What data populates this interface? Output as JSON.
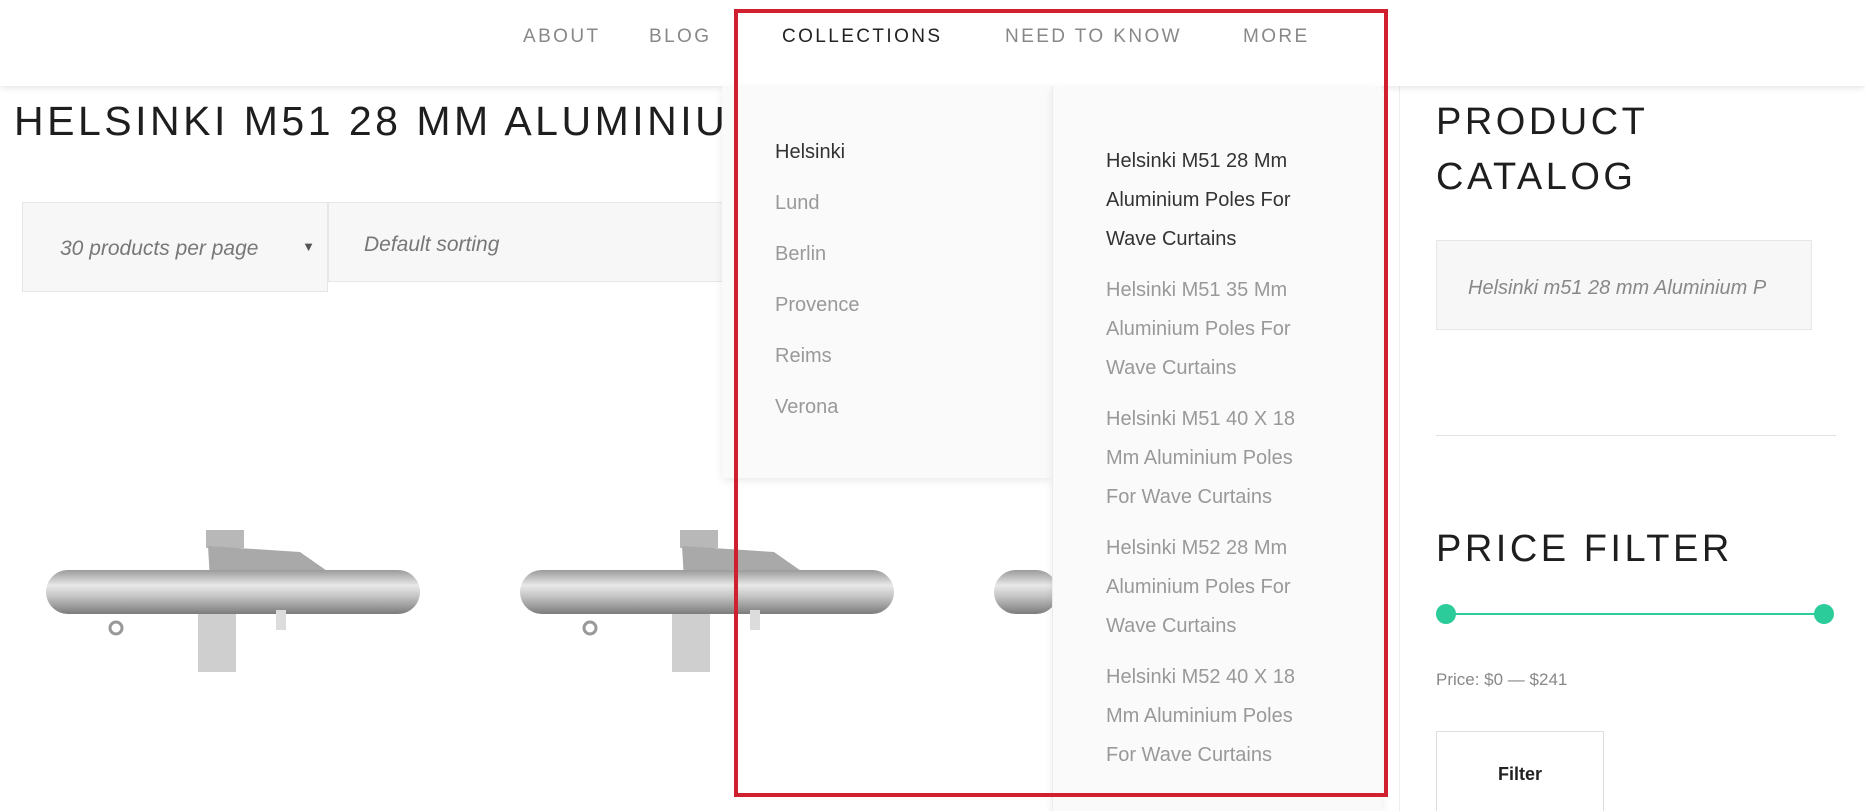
{
  "nav": {
    "about": "ABOUT",
    "blog": "BLOG",
    "collections": "COLLECTIONS",
    "need_to_know": "NEED TO KNOW",
    "more": "MORE"
  },
  "page": {
    "title": "HELSINKI M51 28 MM ALUMINIUM P"
  },
  "controls": {
    "per_page": "30 products per page",
    "sorting": "Default sorting"
  },
  "dropdown": {
    "collections": [
      "Helsinki",
      "Lund",
      "Berlin",
      "Provence",
      "Reims",
      "Verona"
    ],
    "active_collection": "Helsinki",
    "products": [
      [
        "Helsinki M51 28 Mm",
        "Aluminium Poles For",
        "Wave Curtains"
      ],
      [
        "Helsinki M51 35 Mm",
        "Aluminium Poles For",
        "Wave Curtains"
      ],
      [
        "Helsinki M51 40 X 18",
        "Mm Aluminium Poles",
        "For Wave Curtains"
      ],
      [
        "Helsinki M52 28 Mm",
        "Aluminium Poles For",
        "Wave Curtains"
      ],
      [
        "Helsinki M52 40 X 18",
        "Mm Aluminium Poles",
        "For Wave Curtains"
      ]
    ]
  },
  "sidebar": {
    "catalog_title_line1": "PRODUCT",
    "catalog_title_line2": "CATALOG",
    "catalog_select": "Helsinki m51 28 mm Aluminium P",
    "price_title": "PRICE FILTER",
    "price_label": "Price: $0 — $241",
    "filter_button": "Filter"
  },
  "colors": {
    "accent": "#2ccc9a",
    "highlight": "#d0202f"
  }
}
